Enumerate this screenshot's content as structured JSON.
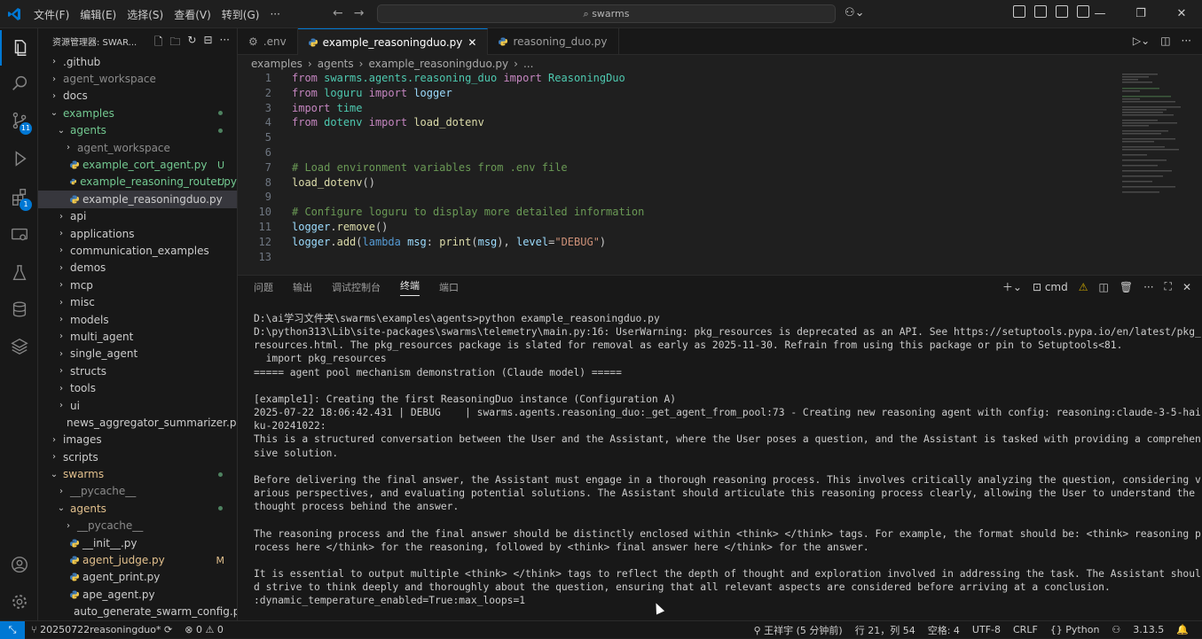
{
  "titlebar": {
    "menu": [
      "文件(F)",
      "编辑(E)",
      "选择(S)",
      "查看(V)",
      "转到(G)",
      "···"
    ],
    "search": "swarms"
  },
  "activity": {
    "scm_badge": "11",
    "ext_badge": "1"
  },
  "explorer": {
    "title": "资源管理器: SWAR...",
    "items": [
      {
        "label": ".github",
        "indent": 1,
        "kind": "folder-closed",
        "color": "normal"
      },
      {
        "label": "agent_workspace",
        "indent": 1,
        "kind": "folder-closed",
        "color": "gray"
      },
      {
        "label": "docs",
        "indent": 1,
        "kind": "folder-closed",
        "color": "normal"
      },
      {
        "label": "examples",
        "indent": 1,
        "kind": "folder-open",
        "color": "green",
        "dot": true
      },
      {
        "label": "agents",
        "indent": 2,
        "kind": "folder-open",
        "color": "green",
        "dot": true
      },
      {
        "label": "agent_workspace",
        "indent": 3,
        "kind": "folder-closed",
        "color": "gray"
      },
      {
        "label": "example_cort_agent.py",
        "indent": 3,
        "kind": "py",
        "color": "green",
        "mark": "U"
      },
      {
        "label": "example_reasoning_router.py",
        "indent": 3,
        "kind": "py",
        "color": "green",
        "mark": "U"
      },
      {
        "label": "example_reasoningduo.py",
        "indent": 3,
        "kind": "py",
        "color": "normal",
        "selected": true
      },
      {
        "label": "api",
        "indent": 2,
        "kind": "folder-closed",
        "color": "normal"
      },
      {
        "label": "applications",
        "indent": 2,
        "kind": "folder-closed",
        "color": "normal"
      },
      {
        "label": "communication_examples",
        "indent": 2,
        "kind": "folder-closed",
        "color": "normal"
      },
      {
        "label": "demos",
        "indent": 2,
        "kind": "folder-closed",
        "color": "normal"
      },
      {
        "label": "mcp",
        "indent": 2,
        "kind": "folder-closed",
        "color": "normal"
      },
      {
        "label": "misc",
        "indent": 2,
        "kind": "folder-closed",
        "color": "normal"
      },
      {
        "label": "models",
        "indent": 2,
        "kind": "folder-closed",
        "color": "normal"
      },
      {
        "label": "multi_agent",
        "indent": 2,
        "kind": "folder-closed",
        "color": "normal"
      },
      {
        "label": "single_agent",
        "indent": 2,
        "kind": "folder-closed",
        "color": "normal"
      },
      {
        "label": "structs",
        "indent": 2,
        "kind": "folder-closed",
        "color": "normal"
      },
      {
        "label": "tools",
        "indent": 2,
        "kind": "folder-closed",
        "color": "normal"
      },
      {
        "label": "ui",
        "indent": 2,
        "kind": "folder-closed",
        "color": "normal"
      },
      {
        "label": "news_aggregator_summarizer.py",
        "indent": 2,
        "kind": "py",
        "color": "normal"
      },
      {
        "label": "images",
        "indent": 1,
        "kind": "folder-closed",
        "color": "normal"
      },
      {
        "label": "scripts",
        "indent": 1,
        "kind": "folder-closed",
        "color": "normal"
      },
      {
        "label": "swarms",
        "indent": 1,
        "kind": "folder-open",
        "color": "mod",
        "dot": true
      },
      {
        "label": "__pycache__",
        "indent": 2,
        "kind": "folder-closed",
        "color": "gray"
      },
      {
        "label": "agents",
        "indent": 2,
        "kind": "folder-open",
        "color": "mod",
        "dot": true
      },
      {
        "label": "__pycache__",
        "indent": 3,
        "kind": "folder-closed",
        "color": "gray"
      },
      {
        "label": "__init__.py",
        "indent": 3,
        "kind": "py",
        "color": "normal"
      },
      {
        "label": "agent_judge.py",
        "indent": 3,
        "kind": "py",
        "color": "mod",
        "mark": "M"
      },
      {
        "label": "agent_print.py",
        "indent": 3,
        "kind": "py",
        "color": "normal"
      },
      {
        "label": "ape_agent.py",
        "indent": 3,
        "kind": "py",
        "color": "normal"
      },
      {
        "label": "auto_generate_swarm_config.py",
        "indent": 3,
        "kind": "py",
        "color": "normal"
      }
    ]
  },
  "tabs": [
    {
      "label": ".env",
      "icon": "gear-icon",
      "active": false
    },
    {
      "label": "example_reasoningduo.py",
      "icon": "python-icon",
      "active": true
    },
    {
      "label": "reasoning_duo.py",
      "icon": "python-icon",
      "active": false
    }
  ],
  "breadcrumb": [
    "examples",
    "agents",
    "example_reasoningduo.py",
    "..."
  ],
  "code": [
    {
      "n": "1",
      "html": "<span class='kw'>from</span> <span class='mod2'>swarms.agents.reasoning_duo</span> <span class='kw'>import</span> <span class='mod2'>ReasoningDuo</span>"
    },
    {
      "n": "2",
      "html": "<span class='kw'>from</span> <span class='mod2'>loguru</span> <span class='kw'>import</span> <span class='var'>logger</span>"
    },
    {
      "n": "3",
      "html": "<span class='kw'>import</span> <span class='mod2'>time</span>"
    },
    {
      "n": "4",
      "html": "<span class='kw'>from</span> <span class='mod2'>dotenv</span> <span class='kw'>import</span> <span class='fn'>load_dotenv</span>"
    },
    {
      "n": "5",
      "html": ""
    },
    {
      "n": "6",
      "html": ""
    },
    {
      "n": "7",
      "html": "<span class='cm'># Load environment variables from .env file</span>"
    },
    {
      "n": "8",
      "html": "<span class='fn'>load_dotenv</span><span class='txt'>()</span>"
    },
    {
      "n": "9",
      "html": ""
    },
    {
      "n": "10",
      "html": "<span class='cm'># Configure loguru to display more detailed information</span>"
    },
    {
      "n": "11",
      "html": "<span class='var'>logger</span><span class='txt'>.</span><span class='fn'>remove</span><span class='txt'>()</span>"
    },
    {
      "n": "12",
      "html": "<span class='var'>logger</span><span class='txt'>.</span><span class='fn'>add</span><span class='txt'>(</span><span class='kw2'>lambda</span> <span class='var'>msg</span><span class='txt'>: </span><span class='fn'>print</span><span class='txt'>(</span><span class='var'>msg</span><span class='txt'>), </span><span class='var'>level</span><span class='txt'>=</span><span class='str'>\"DEBUG\"</span><span class='txt'>)</span>"
    },
    {
      "n": "13",
      "html": ""
    }
  ],
  "panel": {
    "tabs": [
      "问题",
      "输出",
      "调试控制台",
      "终端",
      "端口"
    ],
    "active_tab": "终端",
    "shell": "cmd",
    "terminal": "D:\\ai学习文件夹\\swarms\\examples\\agents>python example_reasoningduo.py\nD:\\python313\\Lib\\site-packages\\swarms\\telemetry\\main.py:16: UserWarning: pkg_resources is deprecated as an API. See https://setuptools.pypa.io/en/latest/pkg_\nresources.html. The pkg_resources package is slated for removal as early as 2025-11-30. Refrain from using this package or pin to Setuptools<81.\n  import pkg_resources\n===== agent pool mechanism demonstration (Claude model) =====\n\n[example1]: Creating the first ReasoningDuo instance (Configuration A)\n2025-07-22 18:06:42.431 | DEBUG    | swarms.agents.reasoning_duo:_get_agent_from_pool:73 - Creating new reasoning agent with config: reasoning:claude-3-5-hai\nku-20241022:\nThis is a structured conversation between the User and the Assistant, where the User poses a question, and the Assistant is tasked with providing a comprehen\nsive solution.\n\nBefore delivering the final answer, the Assistant must engage in a thorough reasoning process. This involves critically analyzing the question, considering v\narious perspectives, and evaluating potential solutions. The Assistant should articulate this reasoning process clearly, allowing the User to understand the\nthought process behind the answer.\n\nThe reasoning process and the final answer should be distinctly enclosed within <think> </think> tags. For example, the format should be: <think> reasoning p\nrocess here </think> for the reasoning, followed by <think> final answer here </think> for the answer.\n\nIt is essential to output multiple <think> </think> tags to reflect the depth of thought and exploration involved in addressing the task. The Assistant shoul\nd strive to think deeply and thoroughly about the question, ensuring that all relevant aspects are considered before arriving at a conclusion.\n:dynamic_temperature_enabled=True:max_loops=1"
  },
  "status": {
    "branch": "20250722reasoningduo*",
    "problems": "0",
    "warnings": "0",
    "author": "王祥宇 (5 分钟前)",
    "position": "行 21，列 54",
    "spaces": "空格: 4",
    "encoding": "UTF-8",
    "eol": "CRLF",
    "language": "Python",
    "version": "3.13.5"
  },
  "colors": {
    "accent": "#0078d4",
    "untracked": "#73c991",
    "modified": "#e2c08d"
  }
}
